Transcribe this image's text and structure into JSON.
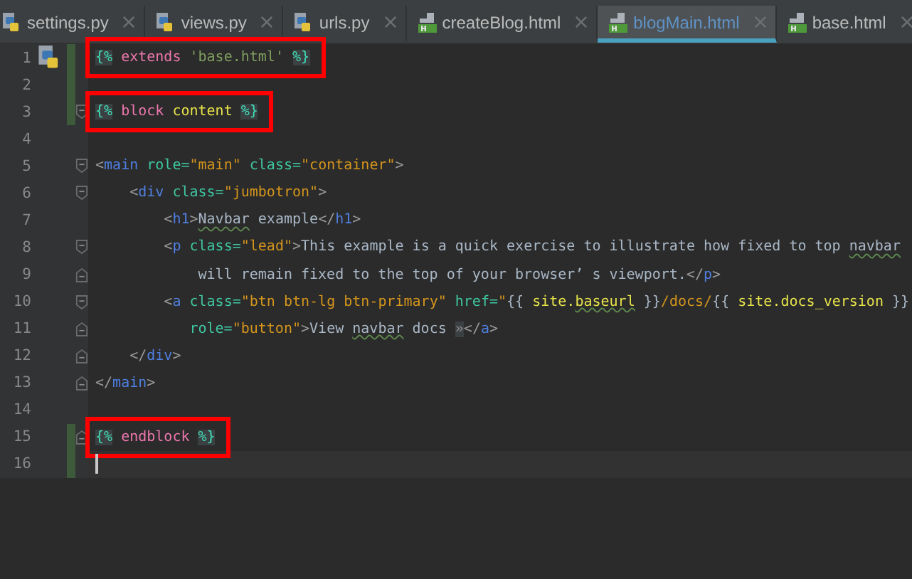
{
  "tabs": [
    {
      "label": "settings.py",
      "kind": "python",
      "selected": false
    },
    {
      "label": "views.py",
      "kind": "python",
      "selected": false
    },
    {
      "label": "urls.py",
      "kind": "python",
      "selected": false
    },
    {
      "label": "createBlog.html",
      "kind": "html",
      "selected": false
    },
    {
      "label": "blogMain.html",
      "kind": "html",
      "selected": true
    },
    {
      "label": "base.html",
      "kind": "html",
      "selected": false
    }
  ],
  "lines": [
    {
      "number": "1",
      "gutter": {
        "kind": "python"
      },
      "changed": true,
      "annotated": true,
      "tokens": [
        {
          "kind": "delim",
          "text": "{%"
        },
        {
          "kind": "keyword",
          "text": " extends"
        },
        {
          "kind": "tstring",
          "text": " 'base.html' "
        },
        {
          "kind": "delim",
          "text": "%}"
        }
      ]
    },
    {
      "number": "2",
      "changed": true
    },
    {
      "number": "3",
      "changed": true,
      "folding": {
        "kind": "start"
      },
      "annotated": true,
      "tokens": [
        {
          "kind": "delim",
          "text": "{%"
        },
        {
          "kind": "keyword",
          "text": " block"
        },
        {
          "kind": "var",
          "text": " content "
        },
        {
          "kind": "delim",
          "text": "%}"
        }
      ]
    },
    {
      "number": "4",
      "changed": false
    },
    {
      "number": "5",
      "changed": false,
      "folding": {
        "kind": "start"
      },
      "tokens": [
        {
          "kind": "punct",
          "text": "<"
        },
        {
          "kind": "tag",
          "text": "main"
        },
        {
          "kind": "attr",
          "text": " role="
        },
        {
          "kind": "string",
          "text": "\"main\""
        },
        {
          "kind": "attr",
          "text": " class="
        },
        {
          "kind": "string",
          "text": "\"container\""
        },
        {
          "kind": "punct",
          "text": ">"
        }
      ]
    },
    {
      "number": "6",
      "changed": false,
      "folding": {
        "kind": "start"
      },
      "tokens": [
        {
          "kind": "punct",
          "text": "    <"
        },
        {
          "kind": "tag",
          "text": "div"
        },
        {
          "kind": "attr",
          "text": " class="
        },
        {
          "kind": "string",
          "text": "\"jumbotron\""
        },
        {
          "kind": "punct",
          "text": ">"
        }
      ]
    },
    {
      "number": "7",
      "changed": false,
      "tokens": [
        {
          "kind": "punct",
          "text": "        <"
        },
        {
          "kind": "tag",
          "text": "h1"
        },
        {
          "kind": "punct",
          "text": ">"
        },
        {
          "kind": "typo",
          "text": "Navbar"
        },
        {
          "kind": "text",
          "text": " example"
        },
        {
          "kind": "punct",
          "text": "</"
        },
        {
          "kind": "tag",
          "text": "h1"
        },
        {
          "kind": "punct",
          "text": ">"
        }
      ]
    },
    {
      "number": "8",
      "changed": false,
      "folding": {
        "kind": "start"
      },
      "tokens": [
        {
          "kind": "punct",
          "text": "        <"
        },
        {
          "kind": "tag",
          "text": "p"
        },
        {
          "kind": "attr",
          "text": " class="
        },
        {
          "kind": "string",
          "text": "\"lead\""
        },
        {
          "kind": "punct",
          "text": ">"
        },
        {
          "kind": "text",
          "text": "This example is a quick exercise to illustrate how fixed to top "
        },
        {
          "kind": "typo",
          "text": "navbar"
        }
      ]
    },
    {
      "number": "9",
      "changed": false,
      "folding": {
        "kind": "end"
      },
      "tokens": [
        {
          "kind": "text",
          "text": "            will remain fixed to the top of your browser’ s viewport."
        },
        {
          "kind": "punct",
          "text": "</"
        },
        {
          "kind": "tag",
          "text": "p"
        },
        {
          "kind": "punct",
          "text": ">"
        }
      ]
    },
    {
      "number": "10",
      "changed": false,
      "folding": {
        "kind": "start"
      },
      "tokens": [
        {
          "kind": "punct",
          "text": "        <"
        },
        {
          "kind": "tag",
          "text": "a"
        },
        {
          "kind": "attr",
          "text": " class="
        },
        {
          "kind": "string",
          "text": "\"btn btn-lg btn-primary\""
        },
        {
          "kind": "attr",
          "text": " href="
        },
        {
          "kind": "string",
          "text": "\""
        },
        {
          "kind": "text",
          "text": "{{"
        },
        {
          "kind": "var",
          "text": " site."
        },
        {
          "kind": "typovar",
          "text": "baseurl"
        },
        {
          "kind": "text",
          "text": " }}"
        },
        {
          "kind": "string",
          "text": "/docs/"
        },
        {
          "kind": "text",
          "text": "{{"
        },
        {
          "kind": "var",
          "text": " site.docs_version"
        },
        {
          "kind": "text",
          "text": " }}"
        }
      ]
    },
    {
      "number": "11",
      "changed": false,
      "folding": {
        "kind": "end"
      },
      "tokens": [
        {
          "kind": "attr",
          "text": "           role="
        },
        {
          "kind": "string",
          "text": "\"button\""
        },
        {
          "kind": "punct",
          "text": ">"
        },
        {
          "kind": "text",
          "text": "View "
        },
        {
          "kind": "typo",
          "text": "navbar"
        },
        {
          "kind": "text",
          "text": " docs "
        },
        {
          "kind": "entity",
          "text": "»"
        },
        {
          "kind": "punct",
          "text": "</"
        },
        {
          "kind": "tag",
          "text": "a"
        },
        {
          "kind": "punct",
          "text": ">"
        }
      ]
    },
    {
      "number": "12",
      "changed": false,
      "folding": {
        "kind": "end"
      },
      "tokens": [
        {
          "kind": "punct",
          "text": "    </"
        },
        {
          "kind": "tag",
          "text": "div"
        },
        {
          "kind": "punct",
          "text": ">"
        }
      ]
    },
    {
      "number": "13",
      "changed": false,
      "folding": {
        "kind": "end"
      },
      "tokens": [
        {
          "kind": "punct",
          "text": "</"
        },
        {
          "kind": "tag",
          "text": "main"
        },
        {
          "kind": "punct",
          "text": ">"
        }
      ]
    },
    {
      "number": "14",
      "changed": false
    },
    {
      "number": "15",
      "changed": true,
      "folding": {
        "kind": "end"
      },
      "annotated": true,
      "tokens": [
        {
          "kind": "delim",
          "text": "{%"
        },
        {
          "kind": "keyword",
          "text": " endblock "
        },
        {
          "kind": "delim",
          "text": "%}"
        }
      ]
    },
    {
      "number": "16",
      "changed": true,
      "current": true
    }
  ]
}
